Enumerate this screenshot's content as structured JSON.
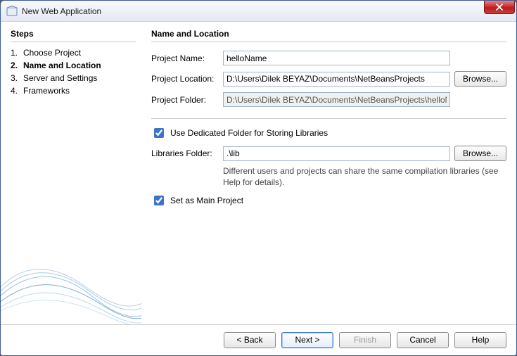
{
  "window": {
    "title": "New Web Application"
  },
  "left": {
    "heading": "Steps",
    "steps": [
      {
        "num": "1.",
        "label": "Choose Project"
      },
      {
        "num": "2.",
        "label": "Name and Location"
      },
      {
        "num": "3.",
        "label": "Server and Settings"
      },
      {
        "num": "4.",
        "label": "Frameworks"
      }
    ],
    "current_index": 1
  },
  "right": {
    "heading": "Name and Location",
    "project_name_label": "Project Name:",
    "project_name_value": "helloName",
    "project_location_label": "Project Location:",
    "project_location_value": "D:\\Users\\Dilek BEYAZ\\Documents\\NetBeansProjects",
    "project_folder_label": "Project Folder:",
    "project_folder_value": "D:\\Users\\Dilek BEYAZ\\Documents\\NetBeansProjects\\helloName",
    "browse_label": "Browse...",
    "use_dedicated_label": "Use Dedicated Folder for Storing Libraries",
    "use_dedicated_checked": true,
    "libraries_folder_label": "Libraries Folder:",
    "libraries_folder_value": ".\\lib",
    "hint_text": "Different users and projects can share the same compilation libraries (see Help for details).",
    "set_main_label": "Set as Main Project",
    "set_main_checked": true
  },
  "footer": {
    "back": "< Back",
    "next": "Next >",
    "finish": "Finish",
    "cancel": "Cancel",
    "help": "Help"
  }
}
